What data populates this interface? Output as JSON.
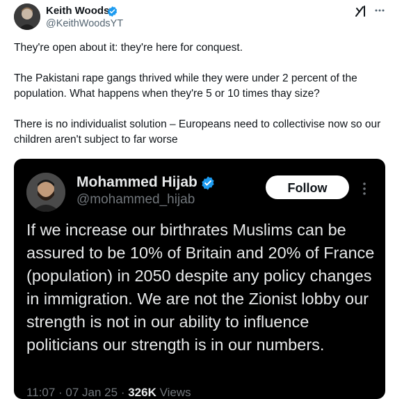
{
  "post": {
    "author_name": "Keith Woods",
    "author_handle": "@KeithWoodsYT",
    "paragraphs": [
      "They're open about it: they're here for conquest.",
      "The Pakistani rape gangs thrived while they were under 2 percent of the population. What happens when they're 5 or 10 times thay size?",
      "There is no individualist solution – Europeans need to collectivise now so our children aren't subject to far worse"
    ]
  },
  "quote": {
    "author_name": "Mohammed Hijab",
    "author_handle": "@mohammed_hijab",
    "follow_label": "Follow",
    "text": "If we increase our birthrates Muslims can be assured to be 10% of Britain and 20% of France (population) in 2050 despite any policy changes in immigration. We are not the Zionist lobby our strength is not in our ability to influence politicians our strength is in our numbers.",
    "time": "11:07",
    "date": "07 Jan 25",
    "views_count": "326K",
    "views_label": "Views"
  },
  "icons": {
    "verified": "verified-badge-icon",
    "grok": "grok-icon",
    "more": "more-options-icon"
  },
  "colors": {
    "verified_blue": "#1d9bf0",
    "text_primary": "#0f1419",
    "text_secondary": "#536471",
    "quote_background": "#000000"
  }
}
